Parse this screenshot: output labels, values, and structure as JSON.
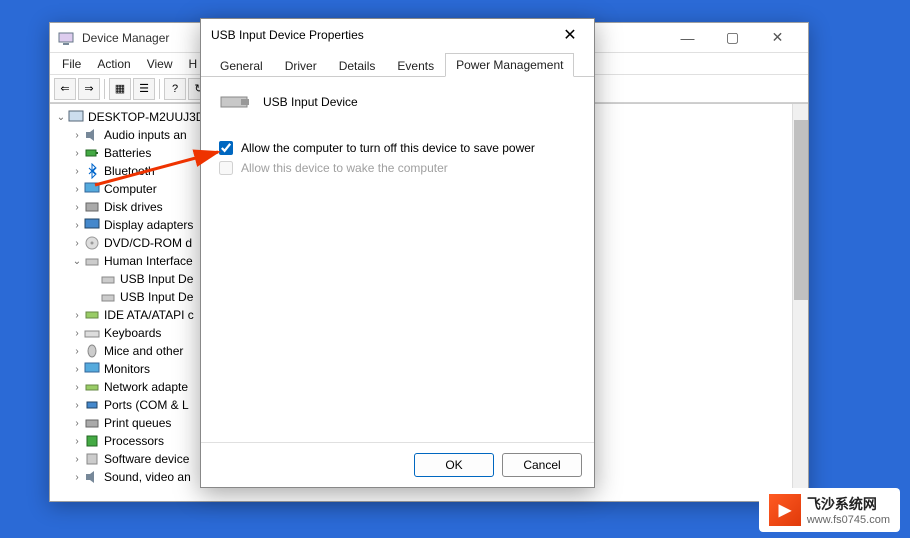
{
  "dm": {
    "title": "Device Manager",
    "menus": [
      "File",
      "Action",
      "View",
      "H"
    ],
    "root": "DESKTOP-M2UUJ3D",
    "items": [
      "Audio inputs an",
      "Batteries",
      "Bluetooth",
      "Computer",
      "Disk drives",
      "Display adapters",
      "DVD/CD-ROM d",
      "Human Interface",
      "USB Input De",
      "USB Input De",
      "IDE ATA/ATAPI c",
      "Keyboards",
      "Mice and other",
      "Monitors",
      "Network adapte",
      "Ports (COM & L",
      "Print queues",
      "Processors",
      "Software device",
      "Sound, video an"
    ]
  },
  "prop": {
    "title": "USB Input Device Properties",
    "tabs": [
      "General",
      "Driver",
      "Details",
      "Events",
      "Power Management"
    ],
    "activeTab": 4,
    "deviceName": "USB Input Device",
    "check1": "Allow the computer to turn off this device to save power",
    "check2": "Allow this device to wake the computer",
    "ok": "OK",
    "cancel": "Cancel"
  },
  "watermark": {
    "name": "飞沙系统网",
    "url": "www.fs0745.com"
  }
}
